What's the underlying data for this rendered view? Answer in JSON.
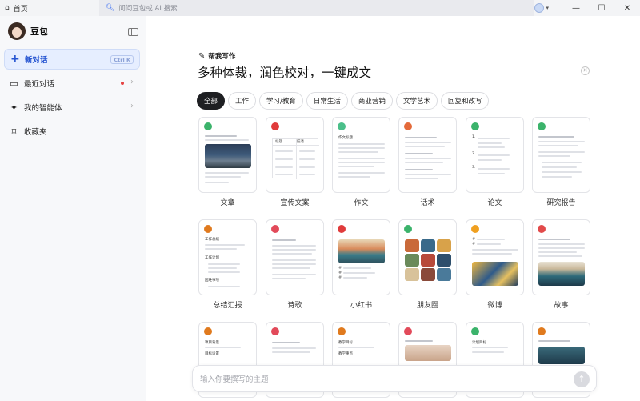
{
  "titlebar": {
    "home_label": "首页",
    "search_placeholder": "问问豆包或 AI 搜索",
    "minimize": "—",
    "maximize": "☐",
    "close": "✕"
  },
  "sidebar": {
    "brand_name": "豆包",
    "items": [
      {
        "label": "新对话",
        "icon": "plus-icon",
        "shortcut": "Ctrl K",
        "active": true
      },
      {
        "label": "最近对话",
        "icon": "chat-bubble-icon",
        "has_dot": true
      },
      {
        "label": "我的智能体",
        "icon": "sparkle-icon"
      },
      {
        "label": "收藏夹",
        "icon": "bookmark-icon"
      }
    ]
  },
  "main": {
    "helper_label": "帮我写作",
    "heading": "多种体裁，润色校对，一键成文",
    "categories": [
      "全部",
      "工作",
      "学习/教育",
      "日常生活",
      "商业营销",
      "文学艺术",
      "回复和改写"
    ],
    "templates_row1": [
      "文章",
      "宣传文案",
      "作文",
      "话术",
      "论文",
      "研究报告"
    ],
    "templates_row2": [
      "总结汇报",
      "诗歌",
      "小红书",
      "朋友圈",
      "微博",
      "故事"
    ],
    "card_texts": {
      "col_a": "标题",
      "col_b": "描述",
      "essay_title": "作文标题",
      "summary_1": "工作总结",
      "summary_2": "工作计划",
      "summary_3": "困难事项",
      "r3_1": "项目背景",
      "r3_1b": "目标设置",
      "r3_3": "教学目标",
      "r3_3b": "教学重点",
      "r3_5": "计划目标"
    },
    "composer_placeholder": "输入你要撰写的主题"
  }
}
